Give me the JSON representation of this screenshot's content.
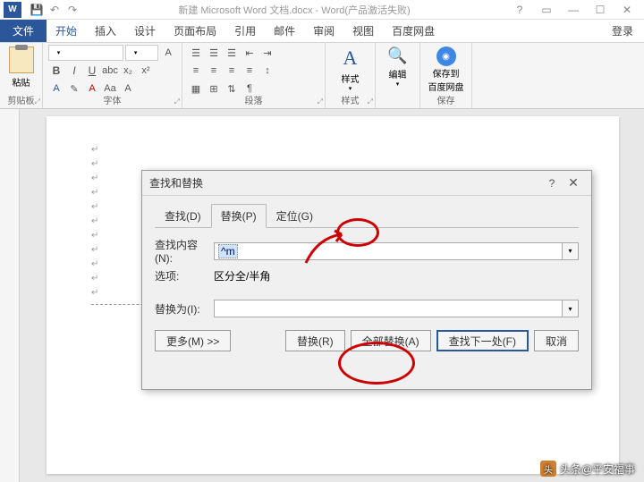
{
  "titlebar": {
    "app_icon": "W",
    "title": "新建 Microsoft Word 文档.docx - Word(产品激活失败)"
  },
  "menubar": {
    "file": "文件",
    "tabs": [
      "开始",
      "插入",
      "设计",
      "页面布局",
      "引用",
      "邮件",
      "审阅",
      "视图",
      "百度网盘"
    ],
    "login": "登录"
  },
  "ribbon": {
    "clipboard": {
      "paste": "粘贴",
      "group": "剪贴板"
    },
    "font": {
      "group": "字体"
    },
    "paragraph": {
      "group": "段落"
    },
    "styles": {
      "label": "样式",
      "group": "样式"
    },
    "editing": {
      "label": "编辑",
      "group": ""
    },
    "save": {
      "label1": "保存到",
      "label2": "百度网盘",
      "group": "保存"
    }
  },
  "dialog": {
    "title": "查找和替换",
    "tabs": {
      "find": "查找(D)",
      "replace": "替换(P)",
      "goto": "定位(G)"
    },
    "find_label": "查找内容(N):",
    "find_value": "^m",
    "options_label": "选项:",
    "options_value": "区分全/半角",
    "replace_label": "替换为(I):",
    "replace_value": "",
    "buttons": {
      "more": "更多(M) >>",
      "replace": "替换(R)",
      "replace_all": "全部替换(A)",
      "find_next": "查找下一处(F)",
      "cancel": "取消"
    }
  },
  "watermark": "头条@平安福事"
}
